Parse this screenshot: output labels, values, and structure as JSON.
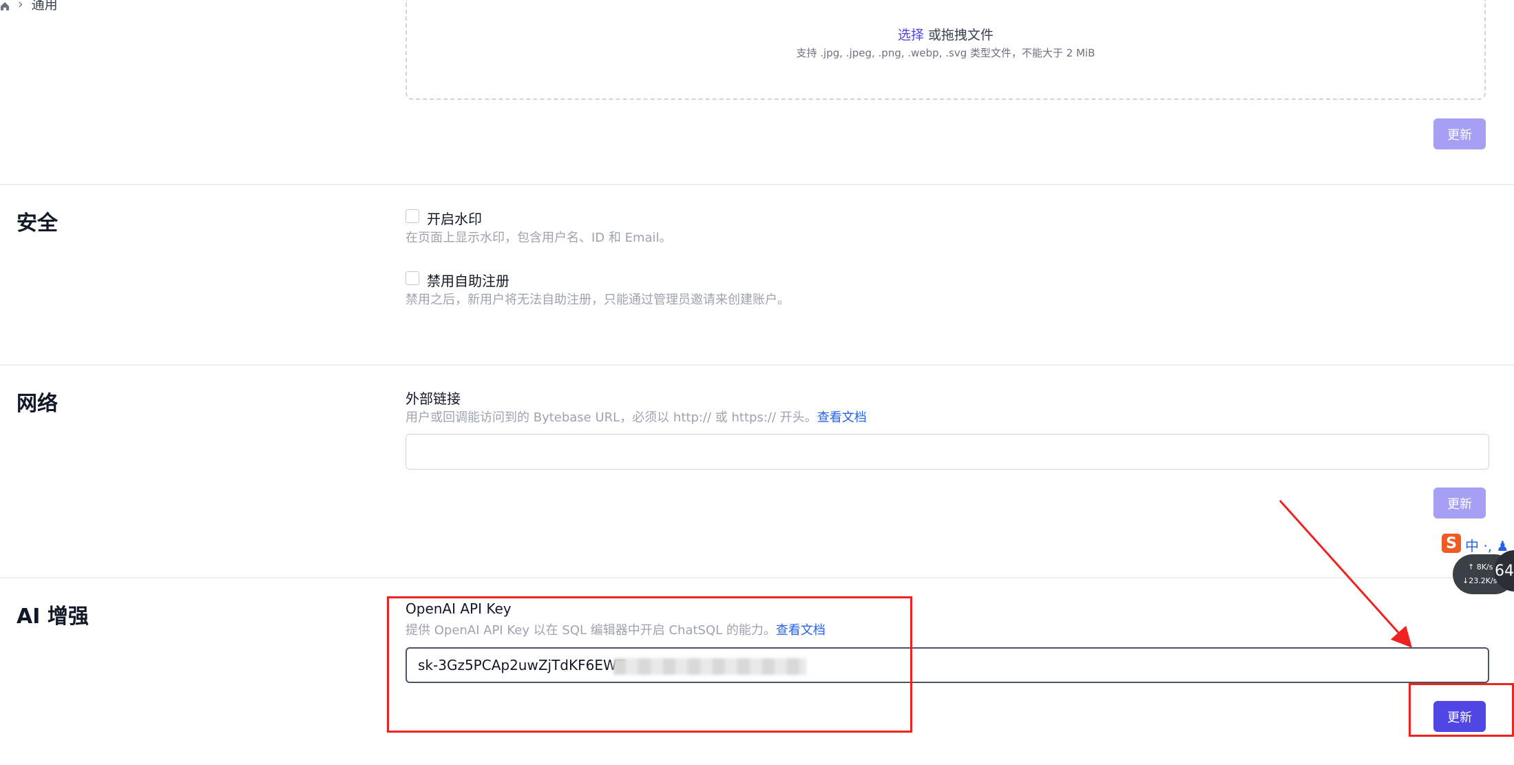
{
  "breadcrumb": {
    "current": "通用"
  },
  "branding": {
    "upload_link": "选择",
    "upload_rest": " 或拖拽文件",
    "upload_hint": "支持 .jpg, .jpeg, .png, .webp, .svg 类型文件，不能大于 2 MiB",
    "update_label": "更新"
  },
  "security": {
    "title": "安全",
    "watermark_label": "开启水印",
    "watermark_help": "在页面上显示水印，包含用户名、ID 和 Email。",
    "watermark_checked": false,
    "signup_label": "禁用自助注册",
    "signup_help": "禁用之后，新用户将无法自助注册，只能通过管理员邀请来创建账户。",
    "signup_checked": false
  },
  "network": {
    "title": "网络",
    "field_label": "外部链接",
    "help": "用户或回调能访问到的 Bytebase URL，必须以 http:// 或 https:// 开头。",
    "doc_link": "查看文档",
    "value": "",
    "update_label": "更新"
  },
  "ai": {
    "title": "AI 增强",
    "field_label": "OpenAI API Key",
    "help": "提供 OpenAI API Key 以在 SQL 编辑器中开启 ChatSQL 的能力。",
    "doc_link": "查看文档",
    "value": "sk-3Gz5PCAp2uwZjTdKF6EWT",
    "update_label": "更新"
  },
  "ime_widget": {
    "logo": "S",
    "mode": "中 ·, ♟",
    "upload_rate": "8",
    "upload_unit": "K/s",
    "download_rate": "23.2",
    "download_unit": "K/s",
    "badge": "64"
  },
  "colors": {
    "primary": "#4f46e5",
    "disabled": "#a5a0f4",
    "annotation": "#ef2222"
  }
}
